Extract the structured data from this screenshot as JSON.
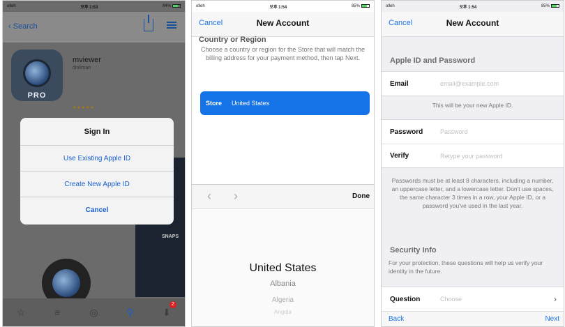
{
  "screen1": {
    "status": {
      "carrier": "olleh",
      "time": "오후 1:53",
      "battery": "84%"
    },
    "back_label": "Search",
    "app": {
      "name": "mviewer",
      "developer": "dinkman",
      "icon_badge": "PRO",
      "rating": "★★★★★"
    },
    "screenshot_text": "SNAPS",
    "dialog": {
      "title": "Sign In",
      "buttons": [
        "Use Existing Apple ID",
        "Create New Apple ID",
        "Cancel"
      ]
    },
    "tabs": [
      "Featured",
      "Top Charts",
      "Explore",
      "Search",
      "Updates"
    ],
    "update_badge": "2"
  },
  "screen2": {
    "status": {
      "carrier": "olleh",
      "time": "오후 1:54",
      "battery": "85%"
    },
    "nav": {
      "cancel": "Cancel",
      "title": "New Account"
    },
    "region_heading": "Country or Region",
    "region_desc": "Choose a country or region for the Store that will match the billing address for your payment method, then tap Next.",
    "store_row": {
      "label": "Store",
      "value": "United States"
    },
    "picker_toolbar": {
      "prev": "‹",
      "next": "›",
      "done": "Done"
    },
    "picker_options": [
      "United States",
      "Albania",
      "Algeria",
      "Angola"
    ]
  },
  "screen3": {
    "status": {
      "carrier": "olleh",
      "time": "오후 1:54",
      "battery": "85%"
    },
    "nav": {
      "cancel": "Cancel",
      "title": "New Account"
    },
    "section_apple_id": "Apple ID and Password",
    "email": {
      "label": "Email",
      "placeholder": "email@example.com"
    },
    "email_note": "This will be your new Apple ID.",
    "password": {
      "label": "Password",
      "placeholder": "Password"
    },
    "verify": {
      "label": "Verify",
      "placeholder": "Retype your password"
    },
    "password_note": "Passwords must be at least 8 characters, including a number, an uppercase letter, and a lowercase letter. Don't use spaces, the same character 3 times in a row, your Apple ID, or a password you've used in the last year.",
    "section_security": "Security Info",
    "security_note": "For your protection, these questions will help us verify your identity in the future.",
    "question": {
      "label": "Question",
      "placeholder": "Choose"
    },
    "bottom": {
      "back": "Back",
      "next": "Next"
    }
  }
}
